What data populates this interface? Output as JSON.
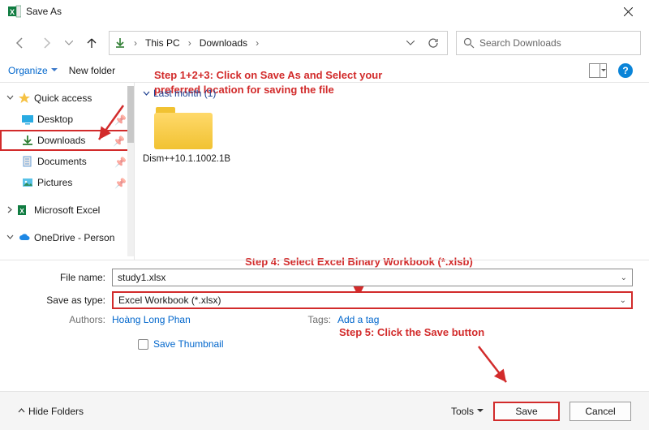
{
  "window": {
    "title": "Save As"
  },
  "addressbar": {
    "crumbs": [
      "This PC",
      "Downloads"
    ],
    "search_placeholder": "Search Downloads"
  },
  "toolbar": {
    "organize": "Organize",
    "new_folder": "New folder"
  },
  "tree": {
    "quick_access": "Quick access",
    "desktop": "Desktop",
    "downloads": "Downloads",
    "documents": "Documents",
    "pictures": "Pictures",
    "excel": "Microsoft Excel",
    "onedrive": "OneDrive - Person"
  },
  "listing": {
    "group_label": "Last month (1)",
    "item1": "Dism++10.1.1002.1B"
  },
  "form": {
    "file_name_label": "File name:",
    "file_name_value": "study1.xlsx",
    "type_label": "Save as type:",
    "type_value": "Excel Workbook (*.xlsx)",
    "authors_label": "Authors:",
    "authors_value": "Hoàng Long Phan",
    "tags_label": "Tags:",
    "tags_value": "Add a tag",
    "save_thumb": "Save Thumbnail"
  },
  "footer": {
    "hide": "Hide Folders",
    "tools": "Tools",
    "save": "Save",
    "cancel": "Cancel"
  },
  "annotations": {
    "step123": "Step 1+2+3: Click on Save As and Select your preferred location for saving the file",
    "step4": "Step 4: Select Excel Binary Workbook (*.xlsb)",
    "step5": "Step 5: Click the Save button"
  }
}
